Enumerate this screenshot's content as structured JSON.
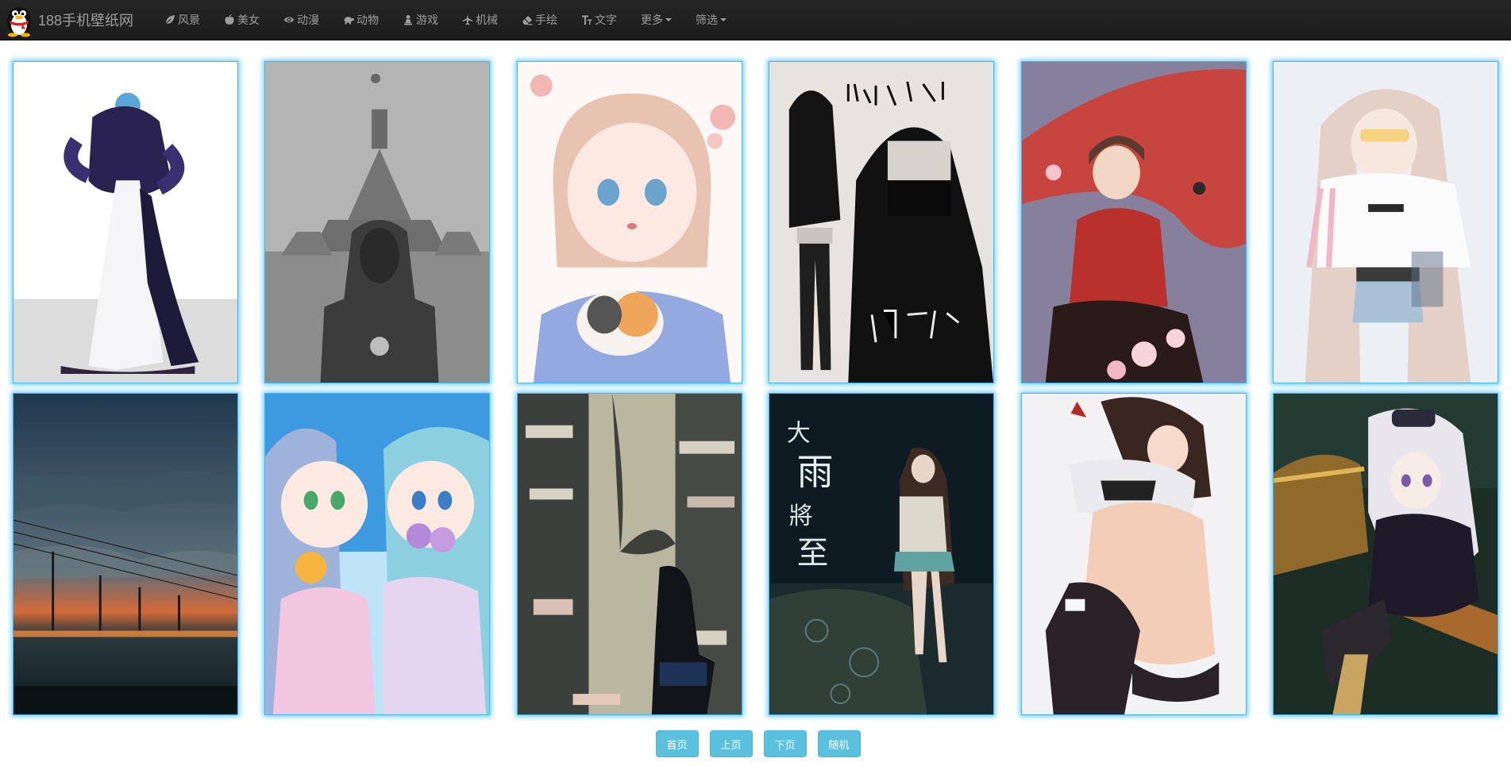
{
  "navbar": {
    "brand": "188手机壁纸网",
    "logo_icon": "penguin-logo-icon",
    "items": [
      {
        "label": "风景",
        "icon": "leaf-icon"
      },
      {
        "label": "美女",
        "icon": "apple-icon"
      },
      {
        "label": "动漫",
        "icon": "eye-icon"
      },
      {
        "label": "动物",
        "icon": "tortoise-icon"
      },
      {
        "label": "游戏",
        "icon": "pawn-icon"
      },
      {
        "label": "机械",
        "icon": "plane-icon"
      },
      {
        "label": "手绘",
        "icon": "erase-icon"
      },
      {
        "label": "文字",
        "icon": "text-size-icon"
      }
    ],
    "dropdowns": [
      {
        "label": "更多"
      },
      {
        "label": "筛选"
      }
    ],
    "colors": {
      "background": "#222222",
      "text": "#9d9d9d"
    }
  },
  "gallery": {
    "rows": 2,
    "columns": 6,
    "border_color": "#3fb7f0"
  },
  "pager": {
    "first": "首页",
    "prev": "上页",
    "next": "下页",
    "random": "随机",
    "color": "#5bc0de"
  }
}
